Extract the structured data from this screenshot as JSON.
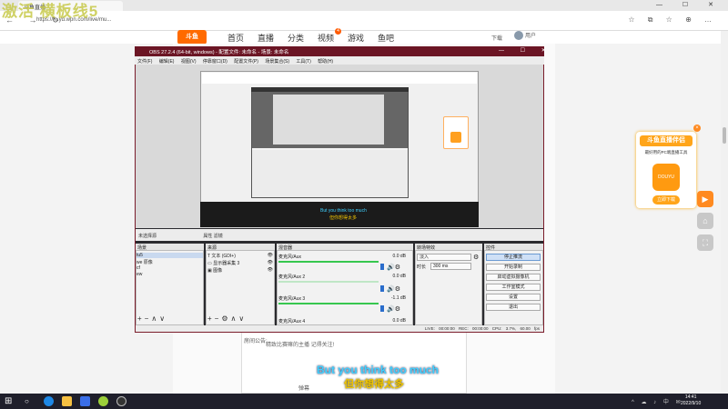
{
  "overlay": {
    "title": "激活 横板线5"
  },
  "browser": {
    "tab_title": "斗鱼直播",
    "url": "https://m.yd.wpn.com/live/mu...",
    "window_controls": "— ☐ ✕",
    "nav_icons": "← → ↻",
    "right_icons": "☆ ⧉ ☆ ⊕ …"
  },
  "site": {
    "logo_text": "斗鱼",
    "nav": [
      "首页",
      "直播",
      "分类",
      "视频",
      "游戏",
      "鱼吧"
    ],
    "video_badge": "4",
    "download": "下载",
    "user": "用户"
  },
  "obs": {
    "title": "OBS 27.2.4 (64-bit, windows) - 配置文件: 未命名 - 场景: 未命名",
    "menu": [
      "文件(F)",
      "编辑(E)",
      "视图(V)",
      "停靠窗口(D)",
      "配置文件(P)",
      "场景集合(S)",
      "工具(T)",
      "帮助(H)"
    ],
    "status_top": "未选择源",
    "status_props": "属性  滤镜",
    "docks": {
      "scenes": {
        "title": "场景",
        "items": [
          "tu5",
          "we 原像",
          "cf",
          "ew"
        ]
      },
      "sources": {
        "title": "来源",
        "items": [
          "文本 (GDI+)",
          "显示器采集 3",
          "图像"
        ]
      },
      "mixer": {
        "title": "混音器",
        "channels": [
          {
            "name": "麦克风/Aux",
            "db": "0.0 dB"
          },
          {
            "name": "麦克风/Aux 2",
            "db": "0.0 dB"
          },
          {
            "name": "麦克风/Aux 3",
            "db": "-1.1 dB"
          },
          {
            "name": "麦克风/Aux 4",
            "db": "0.0 dB"
          }
        ]
      },
      "transitions": {
        "title": "转场特效",
        "type": "淡入",
        "duration_label": "时长",
        "duration": "300 ms"
      },
      "controls": {
        "title": "控件",
        "buttons": [
          "停止推流",
          "开始录制",
          "启动虚拟摄像机",
          "工作室模式",
          "设置",
          "退出"
        ]
      }
    },
    "statusbar": "LIVE: 00:00:00  REC: 00:00:00  CPU: 3.7%, 60.00 fps"
  },
  "preview": {
    "sub_en": "But you think too much",
    "sub_zh": "但你想得太多"
  },
  "page": {
    "chat_line1": "房间公告:",
    "chat_line2": "精致比赛嘛的主播 记得关注!",
    "send_label": "弹幕",
    "subtitle_en": "But you think too much",
    "subtitle_zh": "但你想得太多"
  },
  "ad": {
    "title": "斗鱼直播伴侣",
    "desc": "最好用的PC端直播工具",
    "icon_label": "DOUYU",
    "button": "立即下载",
    "close": "×"
  },
  "side_buttons": [
    "▶",
    "⌂",
    "⛶"
  ],
  "taskbar": {
    "start": "⊞",
    "search": "○",
    "tray": "^ ☁ ♪ 中 ✉",
    "time": "14:41",
    "date": "2022/9/10"
  },
  "colors": {
    "brand": "#ff6a00",
    "obs_titlebar": "#6b1524",
    "subtitle_en": "#3fd0ff",
    "subtitle_zh": "#f0c400"
  }
}
